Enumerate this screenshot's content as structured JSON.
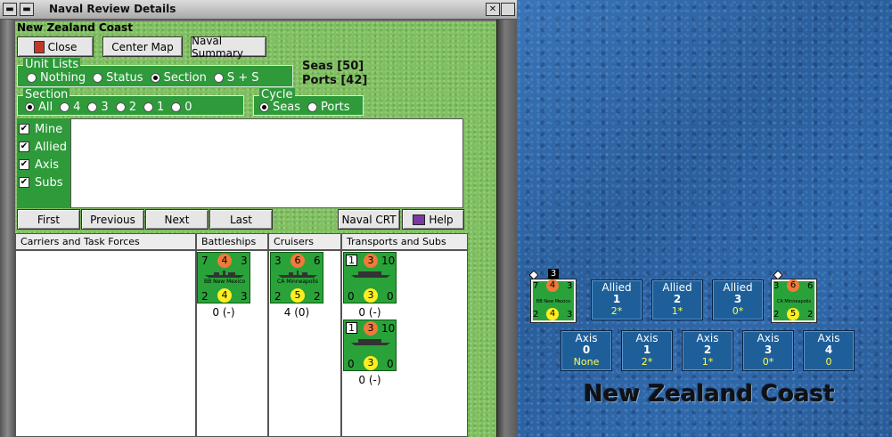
{
  "window": {
    "title": "Naval Review Details",
    "close_glyph": "✕",
    "menu_glyph": "▬"
  },
  "header": {
    "region": "New Zealand Coast"
  },
  "toolbar": {
    "close_label": "Close",
    "center_map_label": "Center Map",
    "naval_summary_label": "Naval Summary"
  },
  "unit_lists": {
    "legend": "Unit Lists",
    "options": [
      "Nothing",
      "Status",
      "Section",
      "S + S"
    ],
    "selected": "Section"
  },
  "counts": {
    "seas": "Seas [50]",
    "ports": "Ports [42]"
  },
  "section": {
    "legend": "Section",
    "options": [
      "All",
      "4",
      "3",
      "2",
      "1",
      "0"
    ],
    "selected": "All"
  },
  "cycle": {
    "legend": "Cycle",
    "options": [
      "Seas",
      "Ports"
    ],
    "selected": "Seas"
  },
  "filters": [
    {
      "label": "Mine",
      "checked": true
    },
    {
      "label": "Allied",
      "checked": true
    },
    {
      "label": "Axis",
      "checked": true
    },
    {
      "label": "Subs",
      "checked": true
    }
  ],
  "nav": {
    "first": "First",
    "previous": "Previous",
    "next": "Next",
    "last": "Last",
    "naval_crt": "Naval CRT",
    "help": "Help"
  },
  "columns": {
    "carriers": "Carriers and Task Forces",
    "battleships": "Battleships",
    "cruisers": "Cruisers",
    "transports": "Transports and Subs"
  },
  "units": {
    "battleship": {
      "tl": "7",
      "tc": "4",
      "tr": "3",
      "bl": "2",
      "bc": "4",
      "br": "3",
      "name": "BB New Mexico",
      "label": "0 (-)"
    },
    "cruiser": {
      "tl": "3",
      "tc": "6",
      "tr": "6",
      "bl": "2",
      "bc": "5",
      "br": "2",
      "name": "CA Minneapolis",
      "label": "4 (0)"
    },
    "transport_1": {
      "sq": "1",
      "tc": "3",
      "tr": "10",
      "bl": "0",
      "bc": "3",
      "br": "0",
      "label": "0 (-)"
    },
    "transport_2": {
      "sq": "1",
      "tc": "3",
      "tr": "10",
      "bl": "0",
      "bc": "3",
      "br": "0",
      "label": "0 (-)"
    }
  },
  "map": {
    "title": "New Zealand Coast",
    "stack_badge": "3",
    "allied_boxes": [
      {
        "side": "Allied",
        "section": "1",
        "value": "2*"
      },
      {
        "side": "Allied",
        "section": "2",
        "value": "1*"
      },
      {
        "side": "Allied",
        "section": "3",
        "value": "0*"
      }
    ],
    "axis_boxes": [
      {
        "side": "Axis",
        "section": "0",
        "value": "None"
      },
      {
        "side": "Axis",
        "section": "1",
        "value": "2*"
      },
      {
        "side": "Axis",
        "section": "2",
        "value": "1*"
      },
      {
        "side": "Axis",
        "section": "3",
        "value": "0*"
      },
      {
        "side": "Axis",
        "section": "4",
        "value": "0"
      }
    ]
  },
  "colors": {
    "panel_green": "#2e9a3a",
    "felt_green": "#7fbf5f",
    "counter_green": "#2aa23a",
    "orange_circle": "#f07a3a",
    "yellow_circle": "#ffee22",
    "chip_blue": "#1e5f9a",
    "chip_value": "#ffff4a"
  }
}
